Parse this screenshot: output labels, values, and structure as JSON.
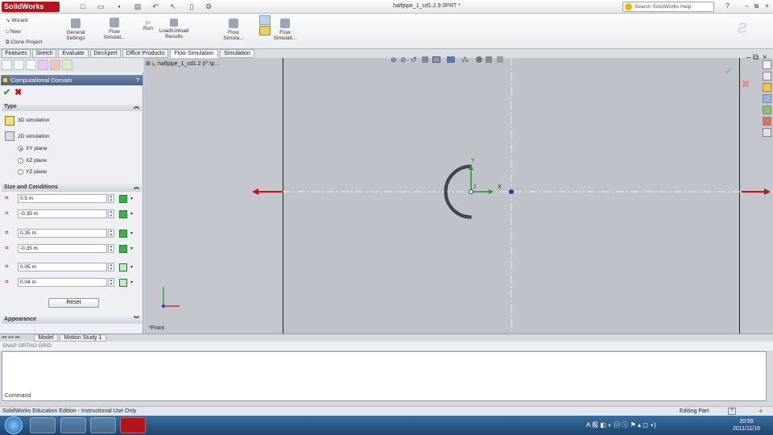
{
  "app": {
    "name": "SolidWorks",
    "document_title": "halfpipe_1_cd1.2.9.0PRT *",
    "search_placeholder": "Search SolidWorks Help"
  },
  "ribbon": {
    "wizard": "Wizard",
    "new": "New",
    "clone_project": "Clone Project",
    "general_settings_1": "General",
    "general_settings_2": "Settings",
    "flow_sim_1": "Flow",
    "flow_sim_2": "Simulat...",
    "run": "Run",
    "load_unload_1": "Load\\Unload",
    "load_unload_2": "Results",
    "flow_sim2_1": "Flow",
    "flow_sim2_2": "Simula...",
    "flow_sim3_1": "Flow",
    "flow_sim3_2": "Simulati..."
  },
  "tabs": [
    "Features",
    "Sketch",
    "Evaluate",
    "DimXpert",
    "Office Products",
    "Flow Simulation",
    "Simulation"
  ],
  "tree": {
    "root": "halfpipe_1_cd1.2 (i^:\\p..."
  },
  "pm": {
    "title": "Computational Domain",
    "help": "?",
    "type_section": "Type",
    "sim3d": "3D simulation",
    "sim2d": "2D simulation",
    "planes": [
      "XY plane",
      "XZ plane",
      "YZ plane"
    ],
    "size_section": "Size and Conditions",
    "fields": [
      "0.5 m",
      "-0.35 m",
      "0.35 m",
      "-0.35 m",
      "0.05 m",
      "0.04 m"
    ],
    "reset": "Reset",
    "appearance": "Appearance"
  },
  "viewport": {
    "orientation": "*Front",
    "axis_x": "X",
    "axis_y": "Y",
    "axis_z": "Z"
  },
  "bottom": {
    "model_tab": "Model",
    "motion_tab": "Motion Study 1",
    "status_line": "SNAP  ORTHO  GRID",
    "command_label": "Command"
  },
  "status": {
    "left": "SolidWorks Education Edition - Instructional Use Only",
    "right": "Editing Part",
    "help": "?"
  },
  "taskbar": {
    "time": "20:55",
    "date": "2011/11/16"
  },
  "colors": {
    "accent": "#b3151b",
    "domain_arrow": "#cc1111",
    "axis_green": "#1f9a2a",
    "axis_blue": "#1a3ad0"
  }
}
